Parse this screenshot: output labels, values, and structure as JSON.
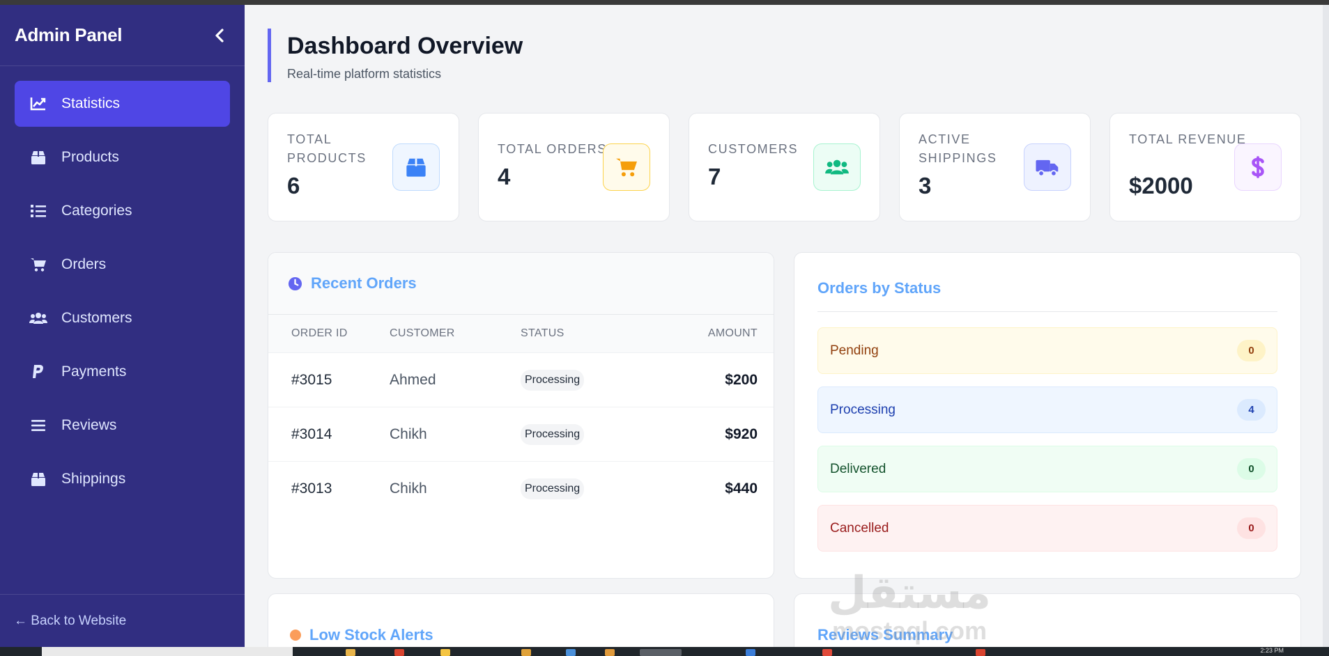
{
  "sidebar": {
    "title": "Admin Panel",
    "items": [
      {
        "label": "Statistics",
        "icon": "chart-line-icon"
      },
      {
        "label": "Products",
        "icon": "box-icon"
      },
      {
        "label": "Categories",
        "icon": "list-icon"
      },
      {
        "label": "Orders",
        "icon": "cart-icon"
      },
      {
        "label": "Customers",
        "icon": "users-icon"
      },
      {
        "label": "Payments",
        "icon": "paypal-icon"
      },
      {
        "label": "Reviews",
        "icon": "bars-icon"
      },
      {
        "label": "Shippings",
        "icon": "box-icon"
      }
    ],
    "active_index": 0,
    "back_link": "← Back to Website"
  },
  "header": {
    "title": "Dashboard Overview",
    "subtitle": "Real-time platform statistics"
  },
  "stats": [
    {
      "label": "Total Products",
      "value": "6",
      "icon": "box-icon",
      "color": "#3b82f6"
    },
    {
      "label": "Total Orders",
      "value": "4",
      "icon": "cart-icon",
      "color": "#f59e0b"
    },
    {
      "label": "Customers",
      "value": "7",
      "icon": "users-icon",
      "color": "#10b981"
    },
    {
      "label": "Active Shippings",
      "value": "3",
      "icon": "truck-icon",
      "color": "#6366f1"
    },
    {
      "label": "Total Revenue",
      "value": "$2000",
      "icon": "dollar-icon",
      "color": "#a855f7"
    }
  ],
  "recent_orders": {
    "title": "Recent Orders",
    "columns": [
      "ORDER ID",
      "CUSTOMER",
      "STATUS",
      "AMOUNT"
    ],
    "rows": [
      {
        "id": "#3015",
        "customer": "Ahmed",
        "status": "Processing",
        "amount": "$200"
      },
      {
        "id": "#3014",
        "customer": "Chikh",
        "status": "Processing",
        "amount": "$920"
      },
      {
        "id": "#3013",
        "customer": "Chikh",
        "status": "Processing",
        "amount": "$440"
      }
    ]
  },
  "orders_by_status": {
    "title": "Orders by Status",
    "items": [
      {
        "label": "Pending",
        "count": "0"
      },
      {
        "label": "Processing",
        "count": "4"
      },
      {
        "label": "Delivered",
        "count": "0"
      },
      {
        "label": "Cancelled",
        "count": "0"
      }
    ]
  },
  "low_stock": {
    "title": "Low Stock Alerts"
  },
  "reviews_summary": {
    "title": "Reviews Summary"
  },
  "watermark": {
    "arabic": "مستقل",
    "latin": "mostaql.com"
  },
  "taskbar": {
    "time": "2:23 PM"
  },
  "colors": {
    "sidebar": "#312e81",
    "accent": "#4f46e5",
    "title_blue": "#60a5fa"
  }
}
